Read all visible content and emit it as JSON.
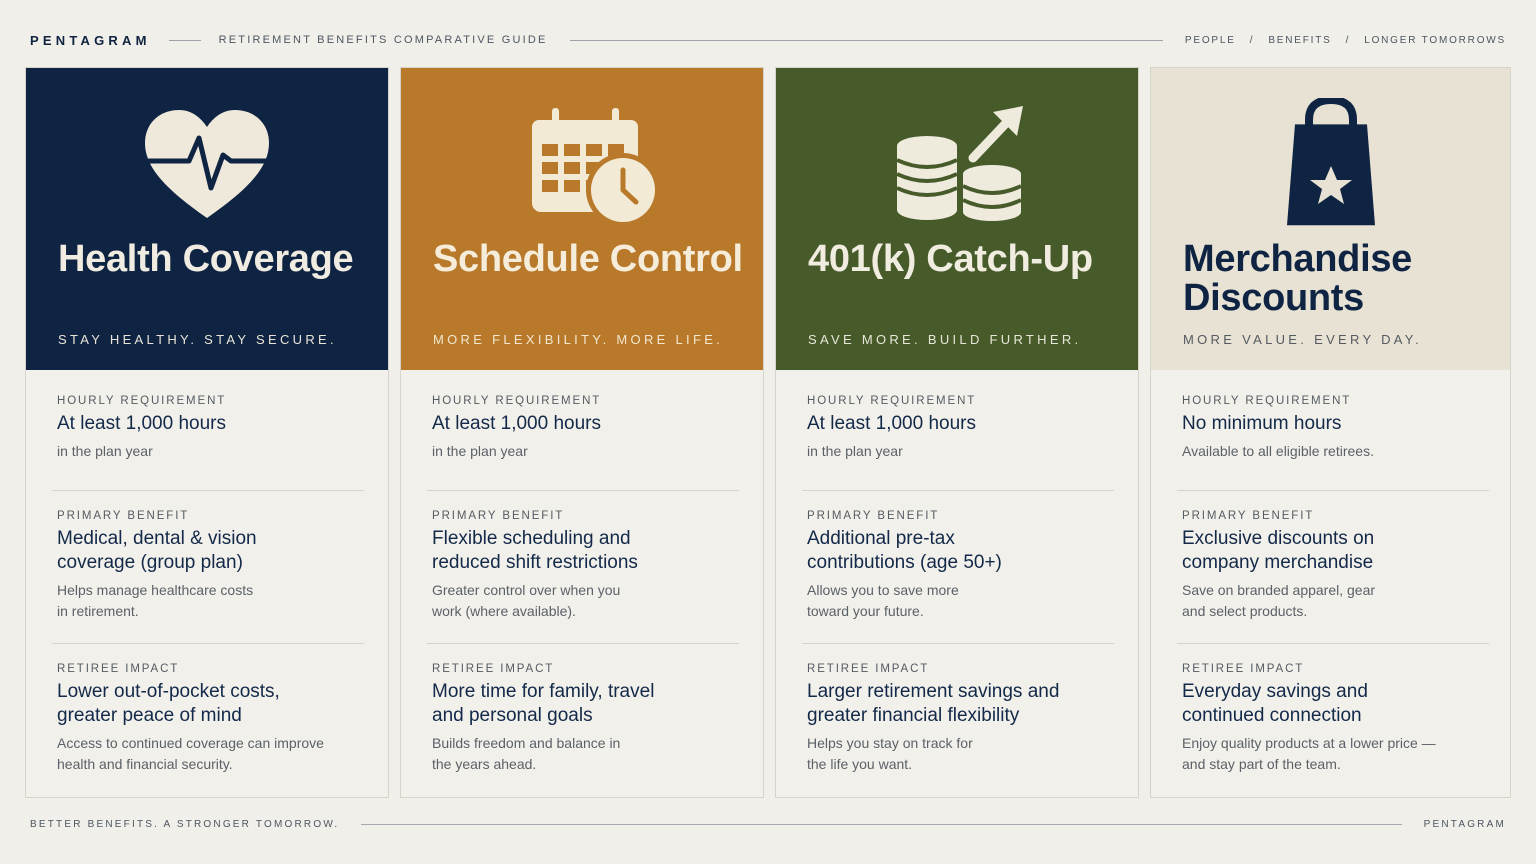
{
  "header": {
    "brand": "PENTAGRAM",
    "guide_title": "RETIREMENT BENEFITS COMPARATIVE GUIDE",
    "breadcrumb": [
      "PEOPLE",
      "BENEFITS",
      "LONGER TOMORROWS"
    ],
    "separator": "/"
  },
  "cards": [
    {
      "icon": "heart-pulse-icon",
      "bg": "#0f2443",
      "title_color": "#f1ece1",
      "tag_color": "#e9e4d8",
      "title": "Health Coverage",
      "tagline": "STAY HEALTHY. STAY SECURE.",
      "sections": [
        {
          "label": "HOURLY REQUIREMENT",
          "value": "At least 1,000 hours",
          "note": "in the plan year"
        },
        {
          "label": "PRIMARY BENEFIT",
          "value": "Medical, dental & vision coverage (group plan)",
          "note": "Helps manage healthcare costs in retirement."
        },
        {
          "label": "RETIREE IMPACT",
          "value": "Lower out-of-pocket costs, greater peace of mind",
          "note": "Access to continued coverage can improve health and financial security."
        }
      ]
    },
    {
      "icon": "calendar-clock-icon",
      "bg": "#b8792b",
      "title_color": "#f5ecd9",
      "tag_color": "#f3e7cf",
      "title": "Schedule Control",
      "tagline": "MORE FLEXIBILITY. MORE LIFE.",
      "sections": [
        {
          "label": "HOURLY REQUIREMENT",
          "value": "At least 1,000 hours",
          "note": "in the plan year"
        },
        {
          "label": "PRIMARY BENEFIT",
          "value": "Flexible scheduling and reduced shift restrictions",
          "note": "Greater control over when you work (where available)."
        },
        {
          "label": "RETIREE IMPACT",
          "value": "More time for family, travel and personal goals",
          "note": "Builds freedom and balance in the years ahead."
        }
      ]
    },
    {
      "icon": "coins-growth-icon",
      "bg": "#475a2a",
      "title_color": "#f0ede0",
      "tag_color": "#e8e6d8",
      "title": "401(k) Catch-Up",
      "tagline": "SAVE MORE. BUILD FURTHER.",
      "sections": [
        {
          "label": "HOURLY REQUIREMENT",
          "value": "At least 1,000 hours",
          "note": "in the plan year"
        },
        {
          "label": "PRIMARY BENEFIT",
          "value": "Additional pre-tax contributions (age 50+)",
          "note": "Allows you to save more toward your future."
        },
        {
          "label": "RETIREE IMPACT",
          "value": "Larger retirement savings and greater financial flexibility",
          "note": "Helps you stay on track for the life you want."
        }
      ]
    },
    {
      "icon": "shopping-bag-star-icon",
      "bg": "#e7e2d4",
      "title_color": "#0f2443",
      "tag_color": "#555a60",
      "title": "Merchandise Discounts",
      "tagline": "MORE VALUE. EVERY DAY.",
      "sections": [
        {
          "label": "HOURLY REQUIREMENT",
          "value": "No minimum hours",
          "note": "Available to all eligible retirees."
        },
        {
          "label": "PRIMARY BENEFIT",
          "value": "Exclusive discounts on company merchandise",
          "note": "Save on branded apparel, gear and select products."
        },
        {
          "label": "RETIREE IMPACT",
          "value": "Everyday savings and continued connection",
          "note": "Enjoy quality products at a lower price — and stay part of the team."
        }
      ]
    }
  ],
  "footer": {
    "left": "BETTER BENEFITS. A STRONGER TOMORROW.",
    "right": "PENTAGRAM"
  }
}
